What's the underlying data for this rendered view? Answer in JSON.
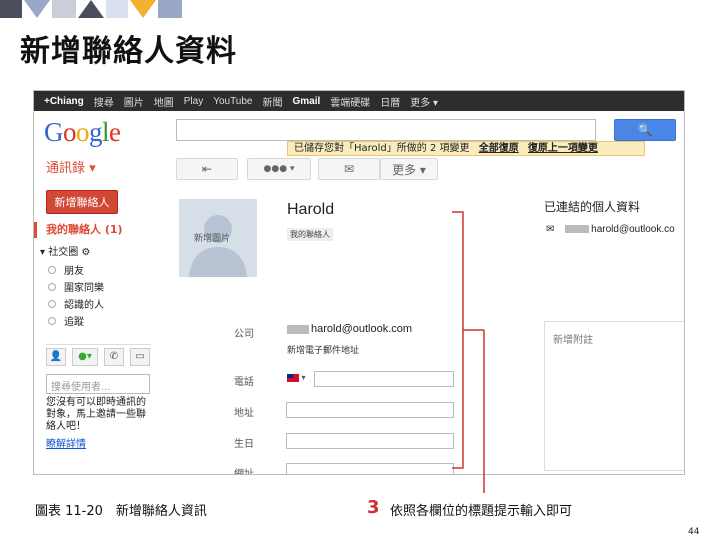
{
  "slide": {
    "title": "新增聯絡人資料",
    "caption_left": "圖表 11-20　新增聯絡人資訊",
    "caption_step": "3",
    "caption_right": "依照各欄位的標題提示輸入即可",
    "page_number": "44"
  },
  "gbar": [
    "+Chiang",
    "搜尋",
    "圖片",
    "地圖",
    "Play",
    "YouTube",
    "新聞",
    "Gmail",
    "雲端硬碟",
    "日曆",
    "更多 ▾"
  ],
  "header": {
    "logo": [
      "G",
      "o",
      "o",
      "g",
      "l",
      "e"
    ],
    "search_icon": "🔍"
  },
  "notice": {
    "text": "已儲存您對「Harold」所做的 2 項變更",
    "undo_all": "全部復原",
    "undo_last": "復原上一項變更"
  },
  "toolbar": {
    "contacts_menu": "通訊錄 ▾",
    "back": "⇤",
    "circles": "●●● ▾",
    "mail": "✉",
    "more": "更多 ▾"
  },
  "sidebar": {
    "new_contact": "新增聯絡人",
    "my_contacts": "我的聯絡人 (1)",
    "circles_header": "▾ 社交圈 ⚙",
    "circles": [
      "朋友",
      "圍家同樂",
      "認識的人",
      "追蹤"
    ],
    "chat_search_placeholder": "搜尋使用者...",
    "chat_note": "您沒有可以即時通訊的對象，馬上邀請一些聯絡人吧！",
    "learn_more": "瞭解詳情"
  },
  "contact": {
    "photo_label": "新增圖片",
    "name": "Harold",
    "group_tag": "我的聯絡人",
    "labels": {
      "company": "公司",
      "phone": "電話",
      "address": "地址",
      "birthday": "生日",
      "url": "網址"
    },
    "email": "harold@outlook.com",
    "add_email": "新增電子郵件地址"
  },
  "linked": {
    "title": "已連結的個人資料",
    "email": "harold@outlook.co"
  },
  "notes": {
    "placeholder": "新增附註"
  },
  "colors": {
    "accent_red": "#dd4b39",
    "callout_red": "#d0312d",
    "search_blue": "#4a86e8"
  }
}
